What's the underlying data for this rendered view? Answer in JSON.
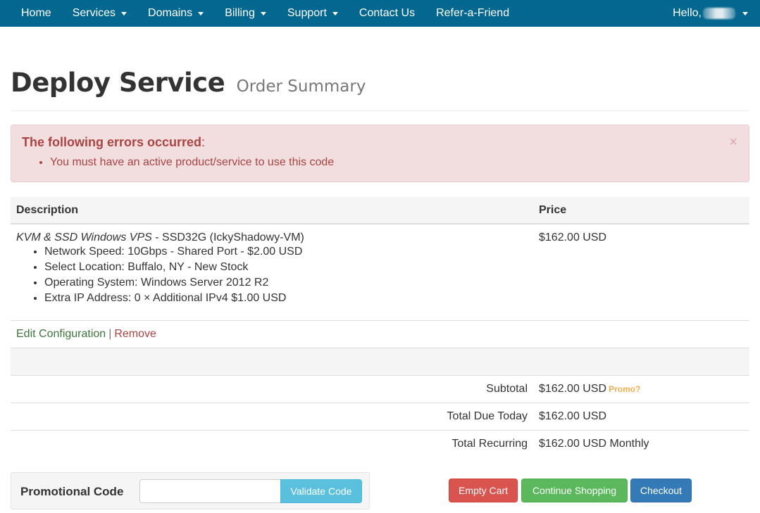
{
  "nav": {
    "items": [
      {
        "label": "Home",
        "dropdown": false
      },
      {
        "label": "Services",
        "dropdown": true
      },
      {
        "label": "Domains",
        "dropdown": true
      },
      {
        "label": "Billing",
        "dropdown": true
      },
      {
        "label": "Support",
        "dropdown": true
      },
      {
        "label": "Contact Us",
        "dropdown": false
      },
      {
        "label": "Refer-a-Friend",
        "dropdown": false
      }
    ],
    "hello": "Hello,"
  },
  "header": {
    "title": "Deploy Service",
    "subtitle": "Order Summary"
  },
  "alert": {
    "heading": "The following errors occurred",
    "heading_suffix": ":",
    "errors": [
      "You must have an active product/service to use this code"
    ],
    "close": "×"
  },
  "table": {
    "headers": {
      "description": "Description",
      "price": "Price"
    },
    "item": {
      "name": "KVM & SSD Windows VPS",
      "name_suffix": " - SSD32G (IckyShadowy-VM)",
      "options": [
        "Network Speed: 10Gbps - Shared Port - $2.00 USD",
        "Select Location: Buffalo, NY - New Stock",
        "Operating System: Windows Server 2012 R2",
        "Extra IP Address: 0 × Additional IPv4 $1.00 USD"
      ],
      "price": "$162.00 USD"
    },
    "actions": {
      "edit": "Edit Configuration",
      "separator": "|",
      "remove": "Remove"
    },
    "totals": {
      "subtotal_label": "Subtotal",
      "subtotal_value": "$162.00 USD",
      "promo_link": "Promo?",
      "due_today_label": "Total Due Today",
      "due_today_value": "$162.00 USD",
      "recurring_label": "Total Recurring",
      "recurring_value": "$162.00 USD Monthly"
    }
  },
  "promo": {
    "label": "Promotional Code",
    "input_value": "",
    "button": "Validate Code"
  },
  "buttons": {
    "empty_cart": "Empty Cart",
    "continue_shopping": "Continue Shopping",
    "checkout": "Checkout"
  },
  "colors": {
    "navbar": "#03678f",
    "alert_bg": "#f2dede",
    "alert_text": "#a94442",
    "btn_danger": "#d9534f",
    "btn_success": "#5cb85c",
    "btn_primary": "#337ab7",
    "btn_info": "#5bc0de",
    "promo_link": "#f0ad4e"
  }
}
